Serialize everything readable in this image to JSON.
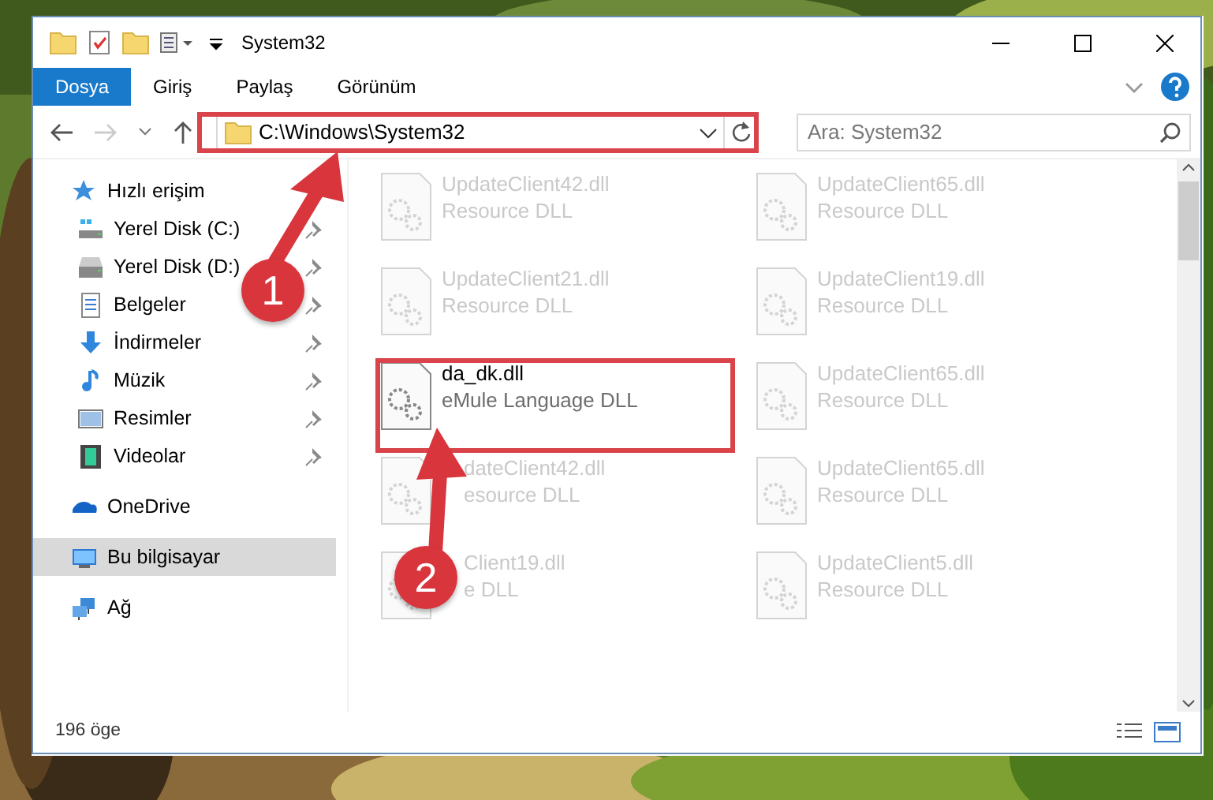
{
  "window": {
    "title": "System32"
  },
  "ribbon": {
    "tabs": [
      {
        "label": "Dosya",
        "selected": true
      },
      {
        "label": "Giriş",
        "selected": false
      },
      {
        "label": "Paylaş",
        "selected": false
      },
      {
        "label": "Görünüm",
        "selected": false
      }
    ]
  },
  "address_bar": {
    "path": "C:\\Windows\\System32"
  },
  "search": {
    "placeholder": "Ara: System32"
  },
  "sidebar": {
    "items": [
      {
        "label": "Hızlı erişim",
        "selected": false,
        "children": [
          {
            "label": "Yerel Disk (C:)",
            "pinned": true
          },
          {
            "label": "Yerel Disk (D:)",
            "pinned": true
          },
          {
            "label": "Belgeler",
            "pinned": true
          },
          {
            "label": "İndirmeler",
            "pinned": true
          },
          {
            "label": "Müzik",
            "pinned": true
          },
          {
            "label": "Resimler",
            "pinned": true
          },
          {
            "label": "Videolar",
            "pinned": true
          }
        ]
      },
      {
        "label": "OneDrive",
        "selected": false
      },
      {
        "label": "Bu bilgisayar",
        "selected": true
      },
      {
        "label": "Ağ",
        "selected": false
      }
    ]
  },
  "files": [
    {
      "name": "UpdateClient42.dll",
      "type": "Resource DLL",
      "dimmed": true
    },
    {
      "name": "UpdateClient65.dll",
      "type": "Resource DLL",
      "dimmed": true
    },
    {
      "name": "UpdateClient21.dll",
      "type": "Resource DLL",
      "dimmed": true
    },
    {
      "name": "UpdateClient19.dll",
      "type": "Resource DLL",
      "dimmed": true
    },
    {
      "name": "da_dk.dll",
      "type": "eMule Language DLL",
      "dimmed": false
    },
    {
      "name": "UpdateClient65.dll",
      "type": "Resource DLL",
      "dimmed": true
    },
    {
      "name": "dateClient42.dll",
      "type": "esource DLL",
      "dimmed": true,
      "covered": true
    },
    {
      "name": "UpdateClient65.dll",
      "type": "Resource DLL",
      "dimmed": true
    },
    {
      "name": "Client19.dll",
      "type": "e DLL",
      "dimmed": true,
      "covered": true
    },
    {
      "name": "UpdateClient5.dll",
      "type": "Resource DLL",
      "dimmed": true
    }
  ],
  "status_bar": {
    "item_count": "196 öge"
  },
  "annotations": [
    {
      "number": "1"
    },
    {
      "number": "2"
    }
  ]
}
